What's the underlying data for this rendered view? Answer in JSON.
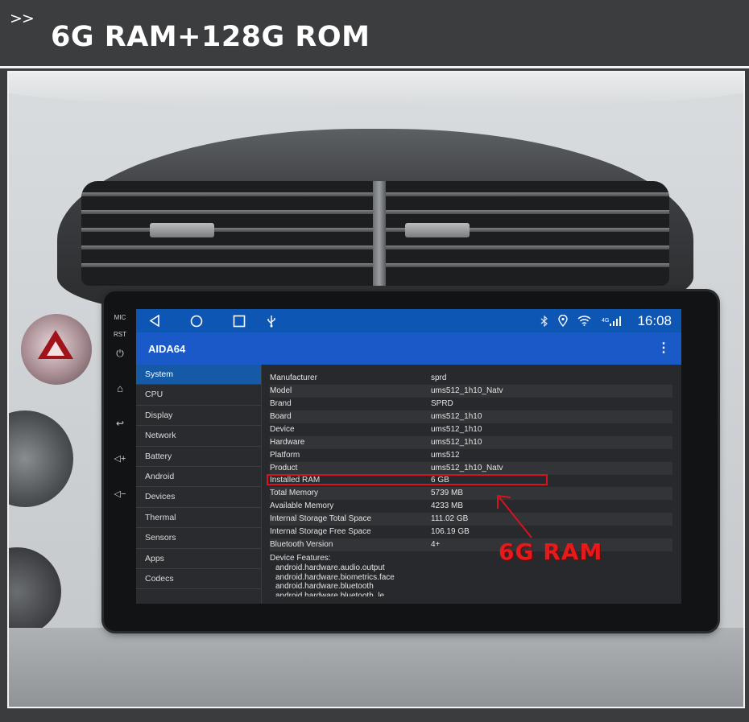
{
  "banner": {
    "arrows": ">>",
    "title": "6G RAM+128G ROM"
  },
  "head_unit": {
    "side_buttons": [
      {
        "label": "MIC",
        "icon": "mic-label"
      },
      {
        "label": "RST",
        "icon": "reset-label"
      },
      {
        "label": "⏻",
        "icon": "power-icon"
      },
      {
        "label": "⌂",
        "icon": "home-icon"
      },
      {
        "label": "↩",
        "icon": "back-icon"
      },
      {
        "label": "◁+",
        "icon": "volume-up-icon"
      },
      {
        "label": "◁−",
        "icon": "volume-down-icon"
      }
    ]
  },
  "statusbar": {
    "time": "16:08",
    "network": "4G",
    "icons": [
      "back-nav-icon",
      "home-nav-icon",
      "recents-nav-icon",
      "usb-icon",
      "bluetooth-icon",
      "location-icon",
      "wifi-icon",
      "signal-icon"
    ]
  },
  "appbar": {
    "title": "AIDA64",
    "menu": "⋮"
  },
  "sidebar": {
    "items": [
      {
        "label": "System",
        "active": true
      },
      {
        "label": "CPU",
        "active": false
      },
      {
        "label": "Display",
        "active": false
      },
      {
        "label": "Network",
        "active": false
      },
      {
        "label": "Battery",
        "active": false
      },
      {
        "label": "Android",
        "active": false
      },
      {
        "label": "Devices",
        "active": false
      },
      {
        "label": "Thermal",
        "active": false
      },
      {
        "label": "Sensors",
        "active": false
      },
      {
        "label": "Apps",
        "active": false
      },
      {
        "label": "Codecs",
        "active": false
      }
    ]
  },
  "system_info": {
    "rows": [
      {
        "key": "Manufacturer",
        "value": "sprd"
      },
      {
        "key": "Model",
        "value": "ums512_1h10_Natv"
      },
      {
        "key": "Brand",
        "value": "SPRD"
      },
      {
        "key": "Board",
        "value": "ums512_1h10"
      },
      {
        "key": "Device",
        "value": "ums512_1h10"
      },
      {
        "key": "Hardware",
        "value": "ums512_1h10"
      },
      {
        "key": "Platform",
        "value": "ums512"
      },
      {
        "key": "Product",
        "value": "ums512_1h10_Natv"
      },
      {
        "key": "Installed RAM",
        "value": "6 GB"
      },
      {
        "key": "Total Memory",
        "value": "5739 MB"
      },
      {
        "key": "Available Memory",
        "value": "4233 MB"
      },
      {
        "key": "Internal Storage Total Space",
        "value": "111.02 GB"
      },
      {
        "key": "Internal Storage Free Space",
        "value": "106.19 GB"
      },
      {
        "key": "Bluetooth Version",
        "value": "4+"
      }
    ],
    "features_label": "Device Features:",
    "features": [
      "android.hardware.audio.output",
      "android.hardware.biometrics.face",
      "android.hardware.bluetooth",
      "android.hardware.bluetooth_le"
    ]
  },
  "annotation": {
    "text": "6G RAM",
    "color": "#e51a1a"
  }
}
